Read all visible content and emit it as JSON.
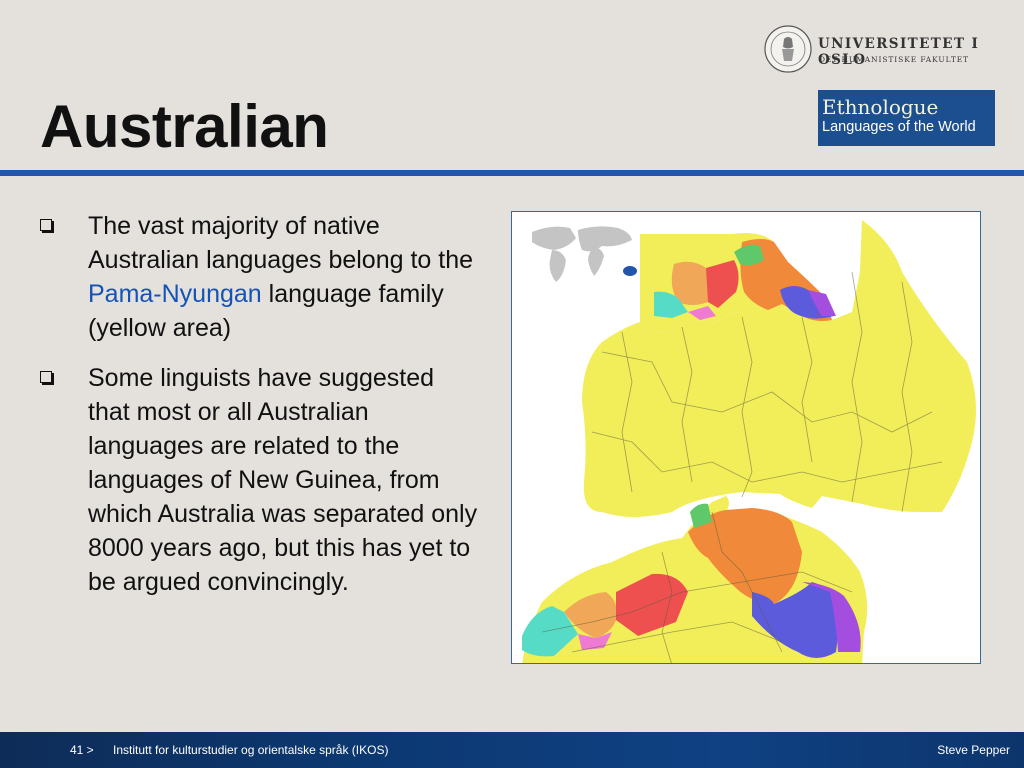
{
  "header": {
    "university_name": "UNIVERSITETET I OSLO",
    "faculty_name": "DET HUMANISTISKE FAKULTET",
    "seal_icon": "university-seal-icon",
    "logo": {
      "line1": "Ethnologue",
      "line2": "Languages of the World"
    }
  },
  "slide": {
    "title": "Australian",
    "bullets": [
      {
        "pre": "The vast majority of native Australian languages belong to the ",
        "highlight": "Pama-Nyungan",
        "post": " language family (yellow area)"
      },
      {
        "pre": "Some linguists have suggested that most or all Australian languages are related to the languages of New Guinea, from which Australia was separated only 8000 years ago, but this has yet to be argued convincingly.",
        "highlight": "",
        "post": ""
      }
    ],
    "bullet_icon": "checkbox-bullet-icon",
    "map_image": "australian-languages-map",
    "colors": {
      "pama_nyungan": "#f2ee5a",
      "highlight": "#1453b5",
      "rule": "#1b5aa6",
      "footer": "#0c3871"
    }
  },
  "footer": {
    "slide_number": "41 >",
    "institute": "Institutt for kulturstudier og orientalske språk (IKOS)",
    "author": "Steve Pepper"
  }
}
